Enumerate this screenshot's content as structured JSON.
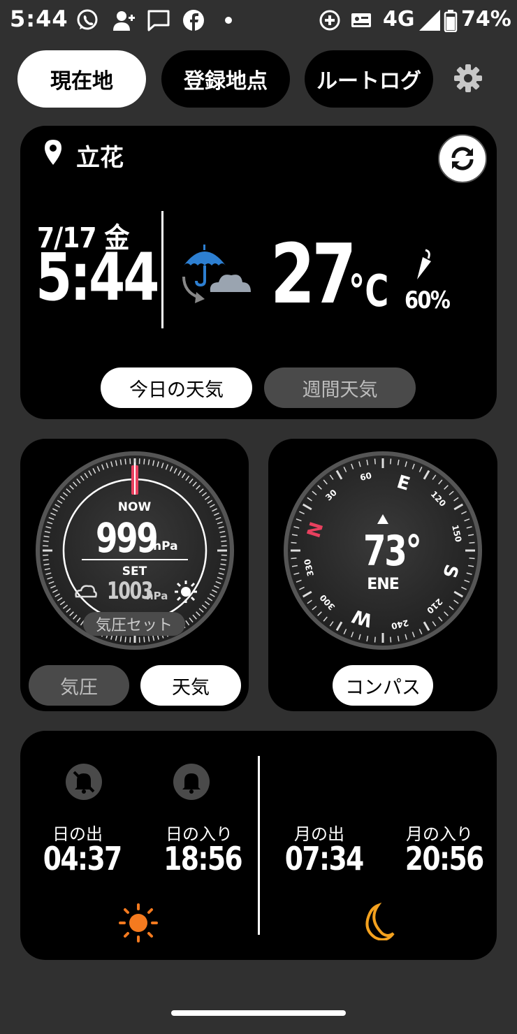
{
  "status_bar": {
    "time": "5:44",
    "network": "4G",
    "battery": "74%"
  },
  "tabs": [
    {
      "label": "現在地",
      "active": true
    },
    {
      "label": "登録地点",
      "active": false
    },
    {
      "label": "ルートログ",
      "active": false
    }
  ],
  "weather": {
    "location": "立花",
    "date": "7/17 金",
    "time": "5:44",
    "temperature": "27",
    "unit": "°C",
    "precip": "60%",
    "today_label": "今日の天気",
    "week_label": "週間天気"
  },
  "barometer": {
    "now_label": "NOW",
    "now_value": "999",
    "unit": "hPa",
    "set_label": "SET",
    "set_value": "1003",
    "set_button": "気圧セット",
    "tab_pressure": "気圧",
    "tab_weather": "天気"
  },
  "compass": {
    "degrees": "73°",
    "direction": "ENE",
    "ring_labels": [
      "E",
      "S",
      "W",
      "N",
      "30",
      "60",
      "120",
      "150",
      "210",
      "240",
      "300",
      "330"
    ],
    "button": "コンパス"
  },
  "sun_moon": {
    "sunrise_label": "日の出",
    "sunrise": "04:37",
    "sunset_label": "日の入り",
    "sunset": "18:56",
    "moonrise_label": "月の出",
    "moonrise": "07:34",
    "moonset_label": "月の入り",
    "moonset": "20:56"
  },
  "colors": {
    "accent_orange": "#f47a1f",
    "needle_red": "#e8405e",
    "umbrella_blue": "#2d7fd1"
  }
}
